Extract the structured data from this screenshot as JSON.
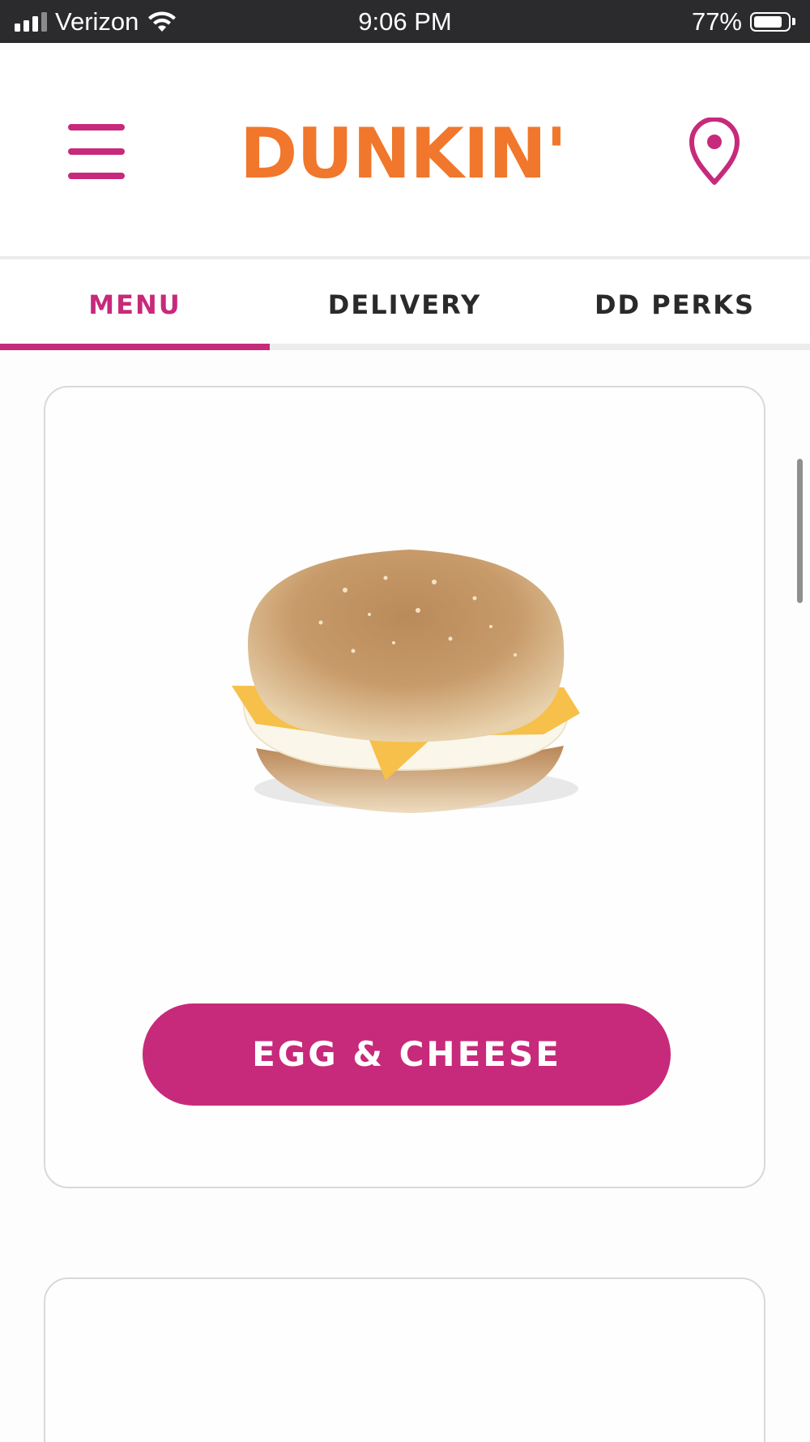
{
  "status_bar": {
    "carrier": "Verizon",
    "time": "9:06 PM",
    "battery_percent": "77%",
    "battery_level": 0.77,
    "signal_bars": 3,
    "icons": [
      "signal-icon",
      "wifi-icon",
      "battery-icon"
    ]
  },
  "header": {
    "logo_text": "DUNKIN'",
    "menu_icon": "hamburger-menu-icon",
    "location_icon": "location-pin-icon"
  },
  "tabs": [
    {
      "label": "MENU",
      "active": true
    },
    {
      "label": "DELIVERY",
      "active": false
    },
    {
      "label": "DD PERKS",
      "active": false
    }
  ],
  "products": [
    {
      "name": "EGG & CHEESE",
      "image": "egg-and-cheese-sandwich-image"
    },
    {
      "name": "",
      "image": ""
    }
  ],
  "colors": {
    "brand_pink": "#c72a7a",
    "brand_orange": "#f0772c",
    "status_bar": "#2b2b2d",
    "text_dark": "#2a2a2a"
  }
}
